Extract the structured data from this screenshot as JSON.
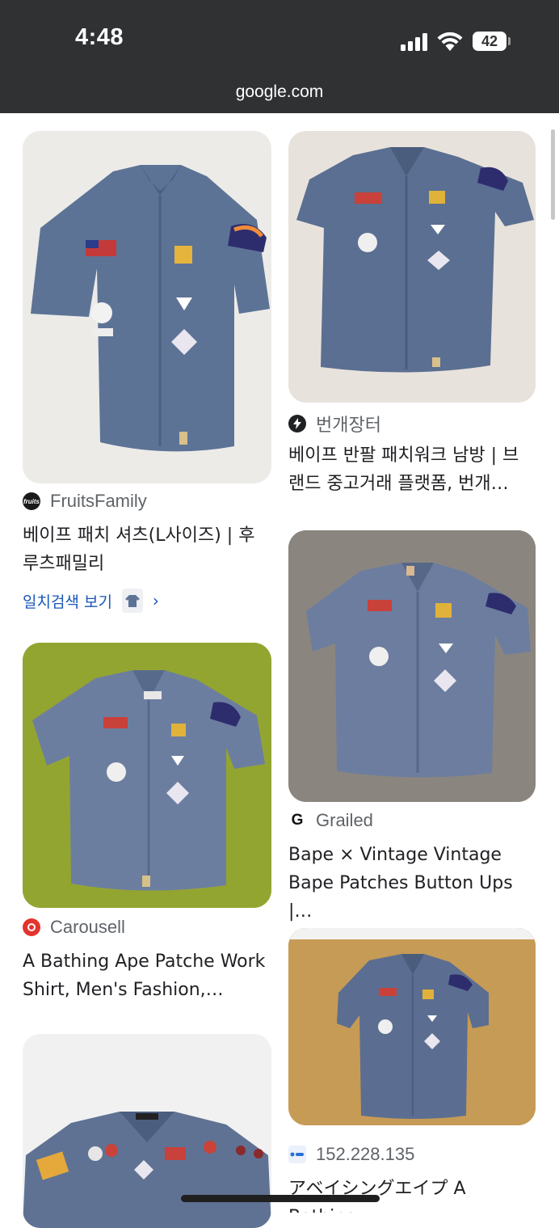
{
  "status_bar": {
    "time": "4:48",
    "battery": "42",
    "url": "google.com"
  },
  "results": [
    {
      "source": "FruitsFamily",
      "source_icon": "fruitsfamily-logo-icon",
      "icon_text": "fruits",
      "title_line1": "베이프 패치 셔츠(L사이즈) | 후",
      "title_line2": "루츠패밀리",
      "exact_match_label": "일치검색 보기"
    },
    {
      "source": "번개장터",
      "source_icon": "bolt-icon",
      "title_line1": "베이프 반팔 패치워크 남방 | 브",
      "title_line2": "랜드 중고거래 플랫폼, 번개…"
    },
    {
      "source": "Grailed",
      "source_icon": "grailed-logo-icon",
      "icon_text": "G",
      "title_line1": "Bape × Vintage Vintage",
      "title_line2": "Bape Patches Button Ups |…"
    },
    {
      "source": "Carousell",
      "source_icon": "carousell-logo-icon",
      "title_line1": "A Bathing Ape Patche Work",
      "title_line2": "Shirt, Men's Fashion,…"
    },
    {
      "source": "152.228.135",
      "source_icon": "site-favicon-icon",
      "title_line1": "アベイシングエイプ A Bathing",
      "title_line2": ""
    }
  ],
  "colors": {
    "status_bar_bg": "#2f3133",
    "link_blue": "#1a56b8",
    "carousell_red": "#e4342d"
  }
}
